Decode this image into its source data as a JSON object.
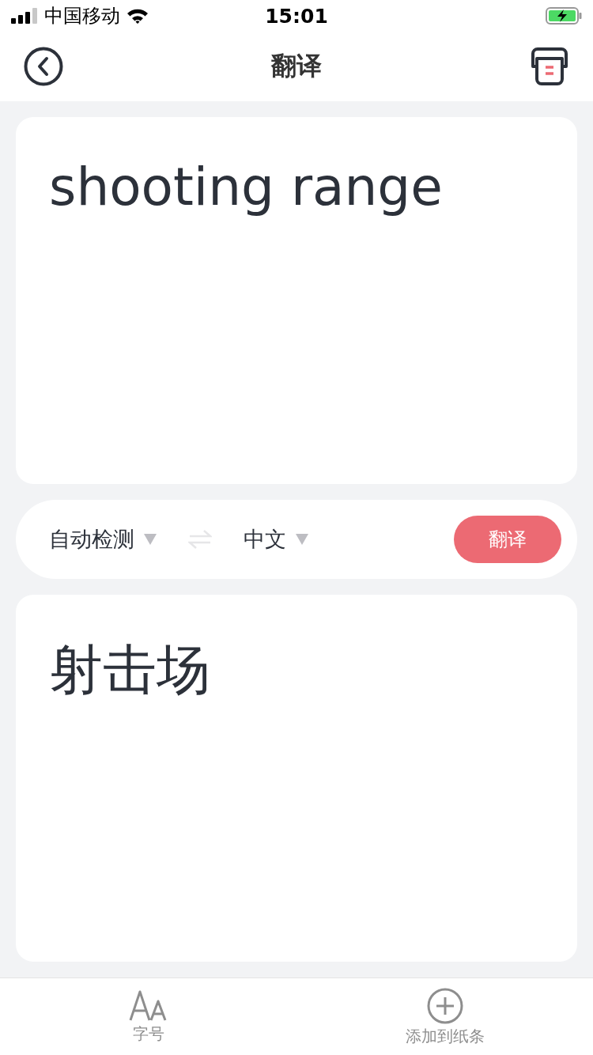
{
  "status_bar": {
    "carrier": "中国移动",
    "time": "15:01"
  },
  "nav": {
    "title": "翻译"
  },
  "source": {
    "value": "shooting range"
  },
  "languages": {
    "from": "自动检测",
    "to": "中文",
    "action": "翻译"
  },
  "result": {
    "text": "射击场"
  },
  "toolbar": [
    {
      "kind": "font",
      "label": "字号"
    },
    {
      "kind": "add",
      "label": "添加到纸条"
    }
  ]
}
